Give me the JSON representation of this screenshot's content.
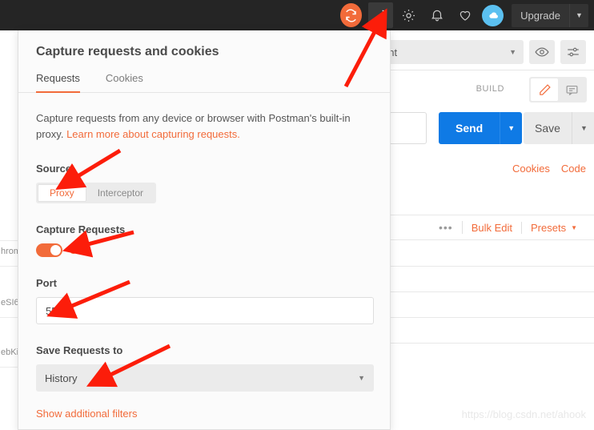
{
  "topbar": {
    "icons": [
      {
        "name": "sync-icon",
        "glyph": "sync"
      },
      {
        "name": "capture-requests-icon",
        "glyph": "satellite"
      },
      {
        "name": "settings-gear-icon",
        "glyph": "gear"
      },
      {
        "name": "notifications-bell-icon",
        "glyph": "bell"
      },
      {
        "name": "favorites-heart-icon",
        "glyph": "heart"
      },
      {
        "name": "account-cloud-icon",
        "glyph": "cloud"
      }
    ],
    "upgrade_label": "Upgrade",
    "upgrade_caret": "▼"
  },
  "background": {
    "environment_select": "vironment",
    "environment_caret": "▼",
    "eye_icon": "eye-icon",
    "filter_icon": "sliders-icon",
    "build_label": "BUILD",
    "edit_icon": "pencil-icon",
    "comment_icon": "comment-icon",
    "send_label": "Send",
    "send_caret": "▼",
    "save_label": "Save",
    "save_caret": "▼",
    "cookies_link": "Cookies",
    "code_link": "Code",
    "dots_label": "•••",
    "bulk_edit_label": "Bulk Edit",
    "presets_label": "Presets",
    "presets_caret": "▼",
    "sidebar_fragments": [
      "hrom",
      "eSI6",
      "ebKit"
    ]
  },
  "modal": {
    "title": "Capture requests and cookies",
    "tabs": [
      {
        "label": "Requests",
        "active": true
      },
      {
        "label": "Cookies",
        "active": false
      }
    ],
    "description_text": "Capture requests from any device or browser with Postman's built-in proxy. ",
    "description_link": "Learn more about capturing requests.",
    "source_label": "Source",
    "source_options": [
      {
        "label": "Proxy",
        "selected": true
      },
      {
        "label": "Interceptor",
        "selected": false
      }
    ],
    "capture_requests_label": "Capture Requests",
    "capture_toggle_state": "ON",
    "port_label": "Port",
    "port_value": "5555",
    "save_requests_label": "Save Requests to",
    "save_requests_value": "History",
    "save_requests_caret": "▼",
    "show_filters_label": "Show additional filters"
  },
  "watermark": "https://blog.csdn.net/ahook",
  "colors": {
    "accent_orange": "#f26b3a",
    "send_blue": "#0f7ae5",
    "topbar_dark": "#252525",
    "annotation_red": "#fc1d0a"
  }
}
